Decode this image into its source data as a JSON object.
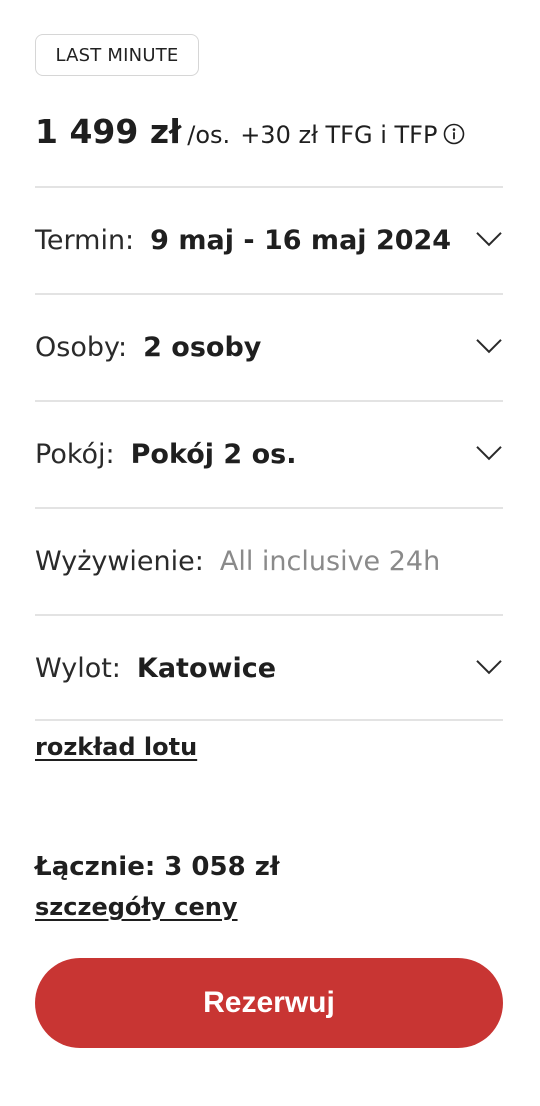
{
  "badge": "LAST MINUTE",
  "price": {
    "amount": "1 499 zł",
    "unit": "/os.",
    "fee": "+30 zł TFG i TFP",
    "info_icon": "info-icon"
  },
  "fields": [
    {
      "label": "Termin:",
      "value": "9 maj - 16 maj 2024",
      "expandable": true
    },
    {
      "label": "Osoby:",
      "value": "2 osoby",
      "expandable": true
    },
    {
      "label": "Pokój:",
      "value": "Pokój 2 os.",
      "expandable": true
    },
    {
      "label": "Wyżywienie:",
      "value": "All inclusive 24h",
      "expandable": false
    },
    {
      "label": "Wylot:",
      "value": "Katowice",
      "expandable": true
    }
  ],
  "links": {
    "flight_schedule": "rozkład lotu",
    "price_details": "szczegóły ceny"
  },
  "total": "Łącznie: 3 058 zł",
  "cta": {
    "label": "Rezerwuj",
    "color": "#c83533"
  }
}
